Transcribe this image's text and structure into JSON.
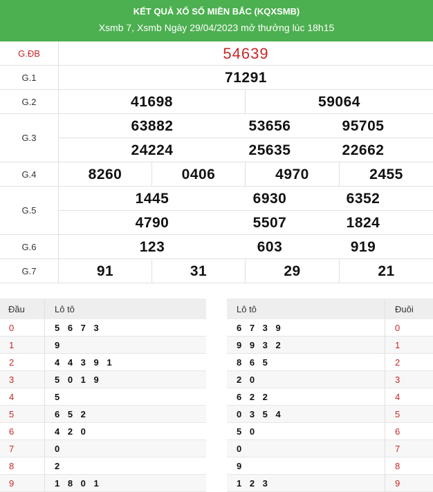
{
  "header": {
    "title": "KẾT QUẢ XỔ SỐ MIỀN BẮC (KQXSMB)",
    "subtitle": "Xsmb 7, Xsmb Ngày 29/04/2023 mở thưởng lúc 18h15"
  },
  "prizes": {
    "db": {
      "label": "G.ĐB",
      "numbers": [
        "54639"
      ]
    },
    "g1": {
      "label": "G.1",
      "numbers": [
        "71291"
      ]
    },
    "g2": {
      "label": "G.2",
      "numbers": [
        "41698",
        "59064"
      ]
    },
    "g3": {
      "label": "G.3",
      "numbers": [
        "63882",
        "53656",
        "95705",
        "24224",
        "25635",
        "22662"
      ]
    },
    "g4": {
      "label": "G.4",
      "numbers": [
        "8260",
        "0406",
        "4970",
        "2455"
      ]
    },
    "g5": {
      "label": "G.5",
      "numbers": [
        "1445",
        "6930",
        "6352",
        "4790",
        "5507",
        "1824"
      ]
    },
    "g6": {
      "label": "G.6",
      "numbers": [
        "123",
        "603",
        "919"
      ]
    },
    "g7": {
      "label": "G.7",
      "numbers": [
        "91",
        "31",
        "29",
        "21"
      ]
    }
  },
  "loto_head": {
    "header_dau": "Đầu",
    "header_loto": "Lô tô",
    "rows": [
      {
        "digit": "0",
        "values": "5 6 7 3"
      },
      {
        "digit": "1",
        "values": "9"
      },
      {
        "digit": "2",
        "values": "4 4 3 9 1"
      },
      {
        "digit": "3",
        "values": "5 0 1 9"
      },
      {
        "digit": "4",
        "values": "5"
      },
      {
        "digit": "5",
        "values": "6 5 2"
      },
      {
        "digit": "6",
        "values": "4 2 0"
      },
      {
        "digit": "7",
        "values": "0"
      },
      {
        "digit": "8",
        "values": "2"
      },
      {
        "digit": "9",
        "values": "1 8 0 1"
      }
    ]
  },
  "loto_tail": {
    "header_loto": "Lô tô",
    "header_duoi": "Đuôi",
    "rows": [
      {
        "digit": "0",
        "values": "6 7 3 9"
      },
      {
        "digit": "1",
        "values": "9 9 3 2"
      },
      {
        "digit": "2",
        "values": "8 6 5"
      },
      {
        "digit": "3",
        "values": "2 0"
      },
      {
        "digit": "4",
        "values": "6 2 2"
      },
      {
        "digit": "5",
        "values": "0 3 5 4"
      },
      {
        "digit": "6",
        "values": "5 0"
      },
      {
        "digit": "7",
        "values": "0"
      },
      {
        "digit": "8",
        "values": "9"
      },
      {
        "digit": "9",
        "values": "1 2 3"
      }
    ]
  },
  "colors": {
    "header_bg": "#4caf50",
    "special_red": "#c62828"
  }
}
